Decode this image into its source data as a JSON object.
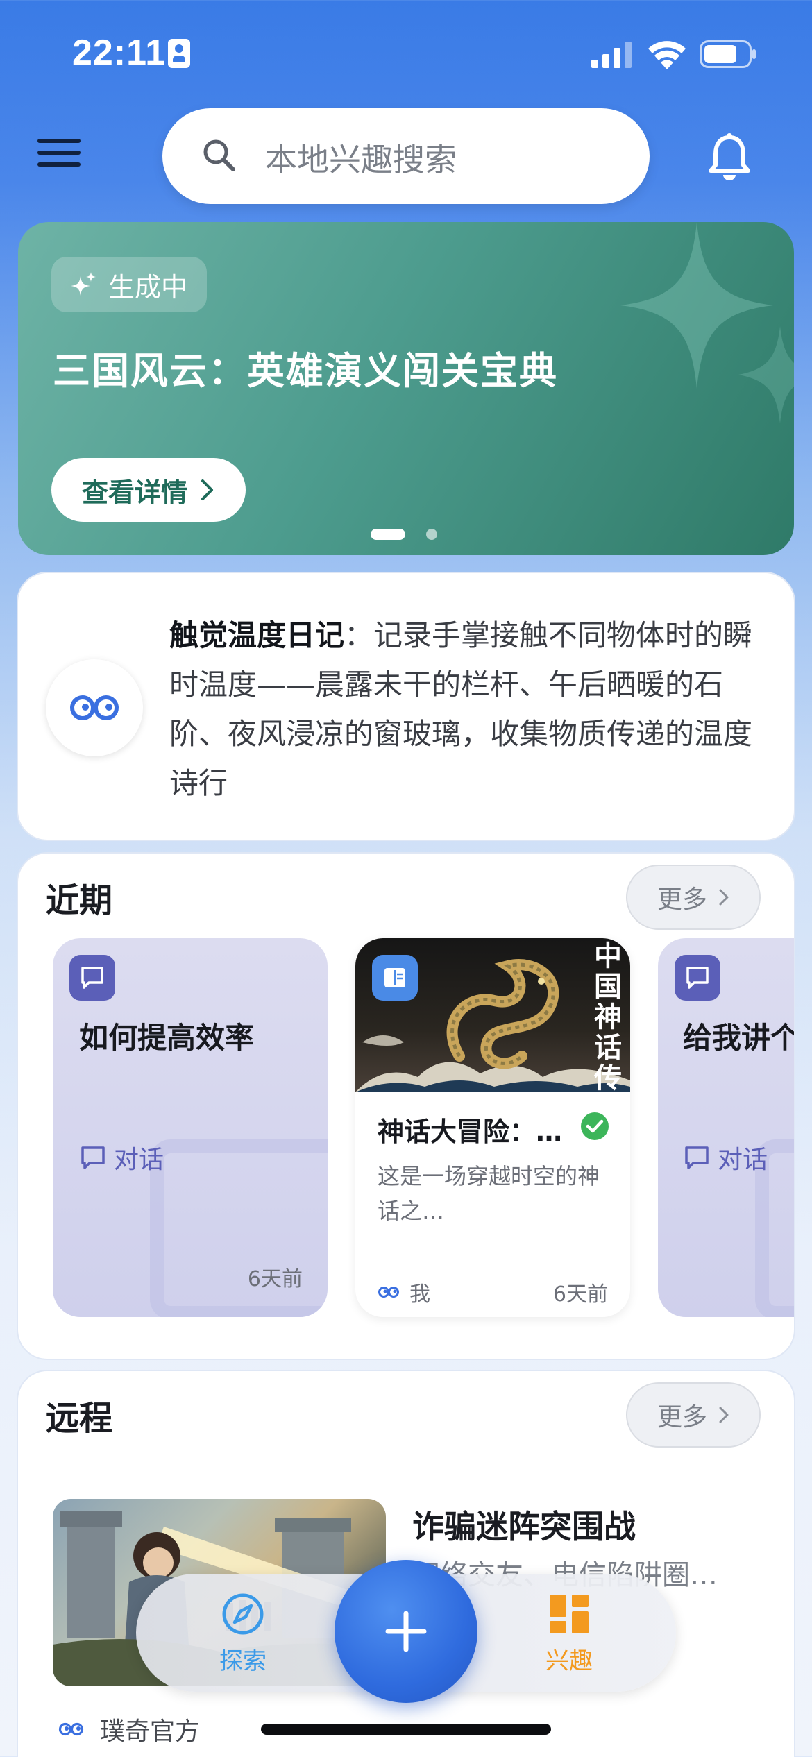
{
  "status_bar": {
    "time": "22:11"
  },
  "search": {
    "placeholder": "本地兴趣搜索"
  },
  "banner": {
    "badge": "生成中",
    "title": "三国风云：英雄演义闯关宝典",
    "button": "查看详情",
    "slide_count": 2,
    "active_slide": 1,
    "color": "#4d9c8e"
  },
  "diary": {
    "title": "触觉温度日记",
    "text": "：记录手掌接触不同物体时的瞬时温度——晨露未干的栏杆、午后晒暖的石阶、夜风浸凉的窗玻璃，收集物质传递的温度诗行"
  },
  "recent": {
    "title": "近期",
    "more": "更多",
    "items": [
      {
        "title": "如何提高效率",
        "type": "对话",
        "time": "6天前",
        "icon": "chat-icon"
      },
      {
        "title": "神话大冒险：…",
        "desc": "这是一场穿越时空的神话之…",
        "author": "我",
        "time": "6天前",
        "icon": "book-icon",
        "image_caption": "中国神话传说",
        "verified": true
      },
      {
        "title": "给我讲个",
        "type": "对话",
        "icon": "chat-icon"
      }
    ]
  },
  "remote": {
    "title": "远程",
    "more": "更多",
    "item": {
      "title": "诈骗迷阵突围战",
      "desc": "网络交友、电信陷阱圈…",
      "author": "璞奇官方"
    }
  },
  "nav": {
    "explore": "探索",
    "interest": "兴趣"
  },
  "colors": {
    "accent": "#2f6bde",
    "explore": "#3b9ae8",
    "interest": "#f39a1f",
    "verified": "#3cb55a"
  }
}
